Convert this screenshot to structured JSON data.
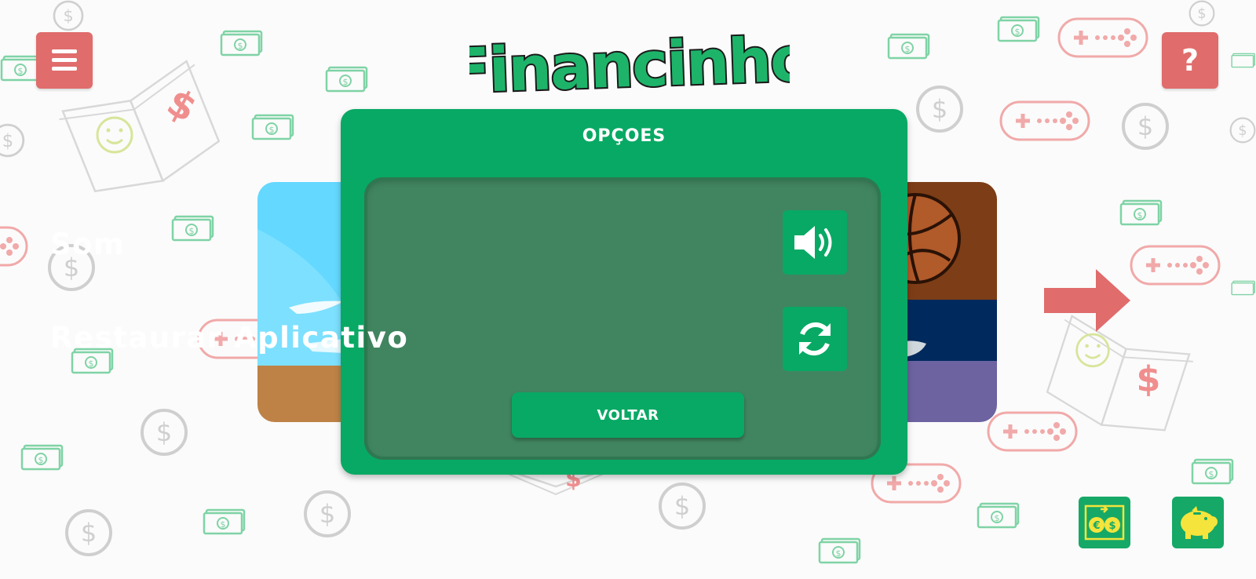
{
  "app": {
    "logo_text": "Financinho"
  },
  "header": {
    "help_label": "?"
  },
  "modal": {
    "title": "OPÇOES",
    "options": [
      {
        "label": "Som",
        "icon": "speaker-icon"
      },
      {
        "label": "Restaurar Aplicativo",
        "icon": "refresh-icon"
      }
    ],
    "back_label": "VOLTAR"
  },
  "colors": {
    "primary_green": "#08a964",
    "panel_green": "#418560",
    "accent_red": "#e06c6c",
    "icon_yellow": "#f4e43c"
  }
}
